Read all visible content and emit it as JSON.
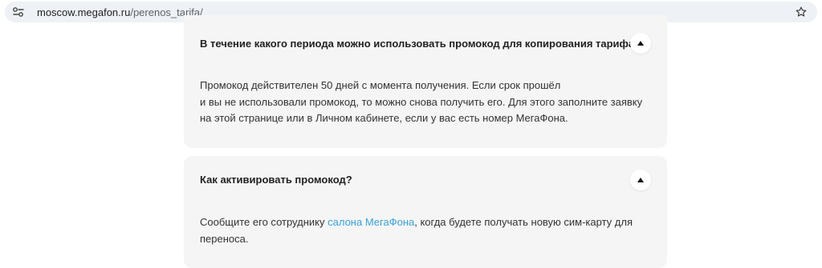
{
  "browser": {
    "url_host": "moscow.megafon.ru",
    "url_path": "/perenos_tarifa/",
    "site_info_icon": "tune-icon",
    "bookmark_icon": "star-outline-icon"
  },
  "faq": [
    {
      "question": "В течение какого периода можно использовать промокод для копирования тарифа?",
      "expanded_icon": "chevron-up-icon",
      "answer_lines": [
        "Промокод действителен 50 дней с момента получения. Если срок прошёл",
        "и вы не использовали промокод, то можно снова получить его. Для этого заполните заявку",
        "на этой странице или в Личном кабинете, если у вас есть номер МегаФона."
      ]
    },
    {
      "question": "Как активировать промокод?",
      "expanded_icon": "chevron-up-icon",
      "answer_pre": "Сообщите его сотруднику ",
      "answer_link": "салона МегаФона",
      "answer_post": ", когда будете получать новую сим-карту для",
      "answer_line2": "переноса."
    }
  ],
  "colors": {
    "card_bg": "#f5f5f5",
    "link": "#3aa1d7",
    "text": "#333333"
  }
}
